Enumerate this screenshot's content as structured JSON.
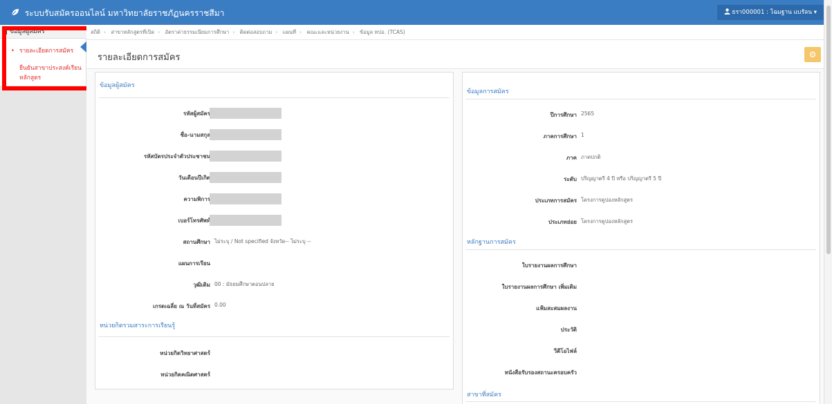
{
  "topbar": {
    "title": "ระบบรับสมัครออนไลน์ มหาวิทยาลัยราชภัฏนครราชสีมา",
    "user": "ธรา000001 : โฉมฐาน แบรัลน ▾"
  },
  "sidebar": {
    "header": "ข้อมูลผู้สมัคร",
    "items": [
      {
        "label": "รายละเอียดการสมัคร"
      },
      {
        "label": "ยืนยันสาขาประสงค์เรียนหลักสูตร"
      }
    ]
  },
  "breadcrumb": [
    "สถิติ",
    "สาขาหลักสูตรที่เปิด",
    "อัตราค่าธรรมเนียมการศึกษา",
    "ติดต่อสอบถาม",
    "แผนที่",
    "คณะและหน่วยงาน",
    "ข้อมูล ทปอ. (TCAS)"
  ],
  "page": {
    "title": "รายละเอียดการสมัคร"
  },
  "applicant": {
    "section_title": "ข้อมูลผู้สมัคร",
    "rows": [
      {
        "label": "รหัสผู้สมัคร",
        "value": ""
      },
      {
        "label": "ชื่อ-นามสกุล",
        "value": ""
      },
      {
        "label": "รหัสบัตรประจำตัวประชาชน",
        "value": ""
      },
      {
        "label": "วันเดือนปีเกิด",
        "value": ""
      },
      {
        "label": "ความพิการ",
        "value": ""
      },
      {
        "label": "เบอร์โทรศัพท์",
        "value": ""
      },
      {
        "label": "สถานศึกษา",
        "value": "ไม่ระบุ / Not specified จังหวัด-- ไม่ระบุ --"
      },
      {
        "label": "แผนการเรียน",
        "value": ""
      },
      {
        "label": "วุฒิเดิม",
        "value": "00 : มัธยมศึกษาตอนปลาย"
      },
      {
        "label": "เกรดเฉลี่ย ณ วันที่สมัคร",
        "value": "0.00"
      }
    ],
    "credits_title": "หน่วยกิตรวมสาระการเรียนรู้",
    "credits": [
      {
        "label": "หน่วยกิตวิทยาศาสตร์"
      },
      {
        "label": "หน่วยกิตคณิตศาสตร์"
      }
    ]
  },
  "application": {
    "section_title": "ข้อมูลการสมัคร",
    "rows": [
      {
        "label": "ปีการศึกษา",
        "value": "2565"
      },
      {
        "label": "ภาคการศึกษา",
        "value": "1"
      },
      {
        "label": "ภาค",
        "value": "ภาคปกติ"
      },
      {
        "label": "ระดับ",
        "value": "ปริญญาตรี 4 ปี หรือ ปริญญาตรี 5 ปี"
      },
      {
        "label": "ประเภทการสมัคร",
        "value": "โครงการคูปองหลักสูตร"
      },
      {
        "label": "ประเภทย่อย",
        "value": "โครงการคูปองหลักสูตร"
      }
    ],
    "evidence_title": "หลักฐานการสมัคร",
    "evidence": [
      {
        "label": "ใบรายงานผลการศึกษา"
      },
      {
        "label": "ใบรายงานผลการศึกษา เพิ่มเติม"
      },
      {
        "label": "แฟ้มสะสมผลงาน"
      },
      {
        "label": "ประวัติ"
      },
      {
        "label": "วีดีโอไฟล์"
      },
      {
        "label": "หนังสือรับรองสถานะครอบครัว"
      }
    ],
    "major_title": "สาขาที่สมัคร"
  }
}
